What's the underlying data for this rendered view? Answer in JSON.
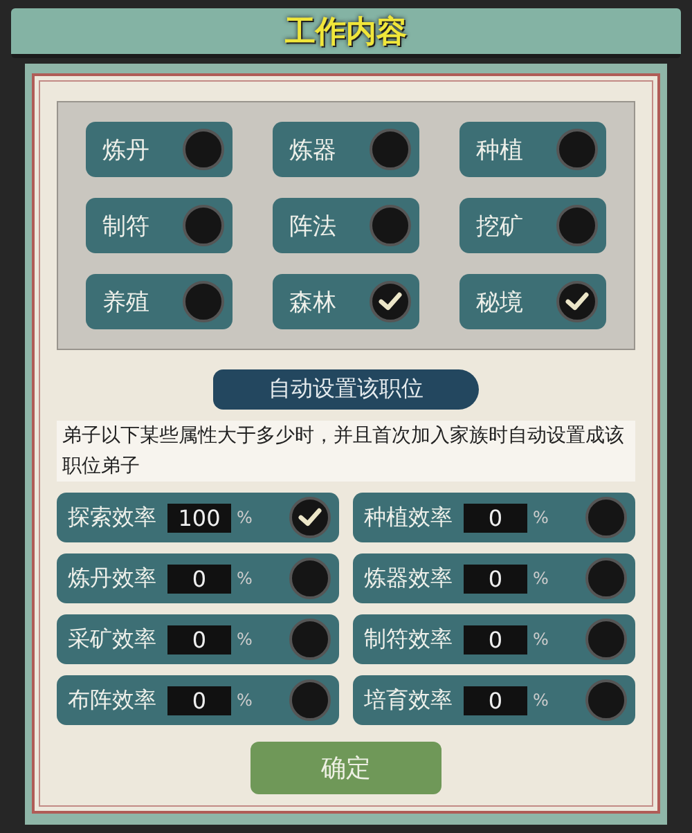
{
  "title": "工作内容",
  "jobs": [
    {
      "label": "炼丹",
      "checked": false
    },
    {
      "label": "炼器",
      "checked": false
    },
    {
      "label": "种植",
      "checked": false
    },
    {
      "label": "制符",
      "checked": false
    },
    {
      "label": "阵法",
      "checked": false
    },
    {
      "label": "挖矿",
      "checked": false
    },
    {
      "label": "养殖",
      "checked": false
    },
    {
      "label": "森林",
      "checked": true
    },
    {
      "label": "秘境",
      "checked": true
    }
  ],
  "auto_section": {
    "heading": "自动设置该职位",
    "description": "弟子以下某些属性大于多少时，并且首次加入家族时自动设置成该职位弟子"
  },
  "thresholds": [
    {
      "label": "探索效率",
      "value": "100",
      "unit": "%",
      "checked": true
    },
    {
      "label": "种植效率",
      "value": "0",
      "unit": "%",
      "checked": false
    },
    {
      "label": "炼丹效率",
      "value": "0",
      "unit": "%",
      "checked": false
    },
    {
      "label": "炼器效率",
      "value": "0",
      "unit": "%",
      "checked": false
    },
    {
      "label": "采矿效率",
      "value": "0",
      "unit": "%",
      "checked": false
    },
    {
      "label": "制符效率",
      "value": "0",
      "unit": "%",
      "checked": false
    },
    {
      "label": "布阵效率",
      "value": "0",
      "unit": "%",
      "checked": false
    },
    {
      "label": "培育效率",
      "value": "0",
      "unit": "%",
      "checked": false
    }
  ],
  "confirm_button": "确定"
}
